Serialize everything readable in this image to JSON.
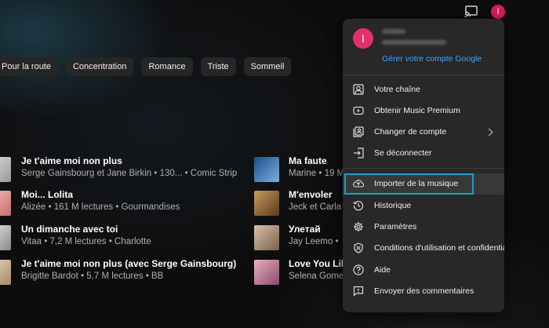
{
  "avatar_initial": "I",
  "chips": [
    "Pour la route",
    "Concentration",
    "Romance",
    "Triste",
    "Sommeil"
  ],
  "songs_left": [
    {
      "title": "Je t'aime moi non plus",
      "meta": "Serge Gainsbourg et Jane Birkin • 130... • Comic Strip"
    },
    {
      "title": "Moi... Lolita",
      "meta": "Alizée • 161 M lectures • Gourmandises"
    },
    {
      "title": "Un dimanche avec toi",
      "meta": "Vitaa • 7,2 M lectures • Charlotte"
    },
    {
      "title": "Je t'aime moi non plus (avec Serge Gainsbourg)",
      "meta": "Brigitte Bardot • 5,7 M lectures • BB"
    }
  ],
  "songs_right": [
    {
      "title": "Ma faute",
      "meta": "Marine • 19 M"
    },
    {
      "title": "M'envoler",
      "meta": "Jeck et Carla •"
    },
    {
      "title": "Улетай",
      "meta": "Jay Leemo •"
    },
    {
      "title": "Love You Like",
      "meta": "Selena Gomez"
    }
  ],
  "menu": {
    "manage_account": "Gérer votre compte Google",
    "items": [
      {
        "label": "Votre chaîne",
        "icon": "person-box-icon"
      },
      {
        "label": "Obtenir Music Premium",
        "icon": "play-badge-icon"
      },
      {
        "label": "Changer de compte",
        "icon": "switch-account-icon"
      },
      {
        "label": "Se déconnecter",
        "icon": "sign-out-icon"
      },
      {
        "label": "Importer de la musique",
        "icon": "cloud-upload-icon"
      },
      {
        "label": "Historique",
        "icon": "history-icon"
      },
      {
        "label": "Paramètres",
        "icon": "gear-icon"
      },
      {
        "label": "Conditions d'utilisation et confidentialité",
        "icon": "shield-icon"
      },
      {
        "label": "Aide",
        "icon": "help-icon"
      },
      {
        "label": "Envoyer des commentaires",
        "icon": "feedback-icon"
      }
    ]
  },
  "colors": {
    "accent_link": "#3ea6ff",
    "avatar": "#e23068",
    "highlight_border": "#1a9fc9"
  }
}
